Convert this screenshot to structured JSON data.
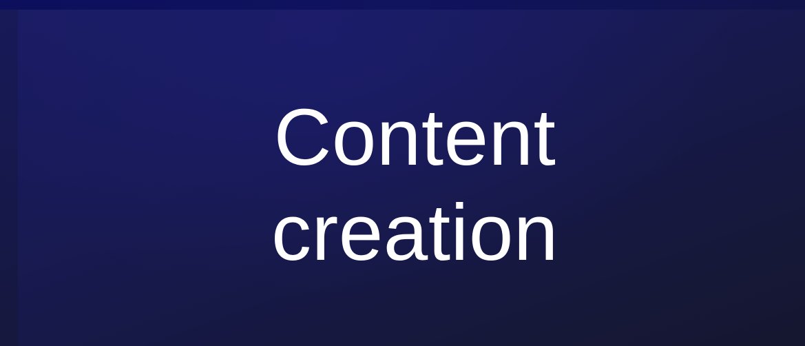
{
  "tile": {
    "title_line_1": "Content",
    "title_line_2": "creation"
  },
  "colors": {
    "background_dark": "#15172f",
    "background_light": "#191b62",
    "text": "#ffffff"
  }
}
